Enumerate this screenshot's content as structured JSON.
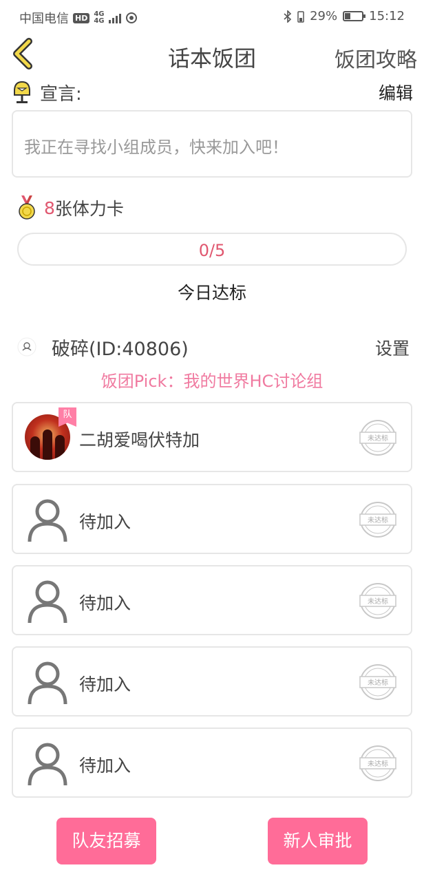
{
  "status_bar": {
    "carrier": "中国电信",
    "hd": "HD",
    "network_top": "4G",
    "network_bottom": "4G",
    "battery_percent": "29%",
    "battery_level": 0.29,
    "time": "15:12"
  },
  "header": {
    "title": "话本饭团",
    "strategy_label": "饭团攻略"
  },
  "declaration": {
    "label": "宣言:",
    "edit_label": "编辑",
    "text": "我正在寻找小组成员，快来加入吧！"
  },
  "stamina": {
    "count": "8",
    "label": "张体力卡"
  },
  "progress": {
    "text": "0/5",
    "value": 0,
    "max": 5
  },
  "daily_label": "今日达标",
  "leader": {
    "name": "破碎(ID:40806)",
    "settings_label": "设置"
  },
  "pick": "饭团Pick：我的世界HC讨论组",
  "members": [
    {
      "name": "二胡爱喝伏特加",
      "tag": "队",
      "stamp": "未达标"
    },
    {
      "name": "待加入",
      "stamp": "未达标"
    },
    {
      "name": "待加入",
      "stamp": "未达标"
    },
    {
      "name": "待加入",
      "stamp": "未达标"
    },
    {
      "name": "待加入",
      "stamp": "未达标"
    }
  ],
  "actions": {
    "recruit": "队友招募",
    "approve": "新人审批"
  },
  "colors": {
    "accent": "#ff6c98",
    "accent_text": "#e0576f",
    "pick_text": "#f07aa0",
    "back_arrow": "#f2d84a",
    "border": "#e6e6e6"
  }
}
